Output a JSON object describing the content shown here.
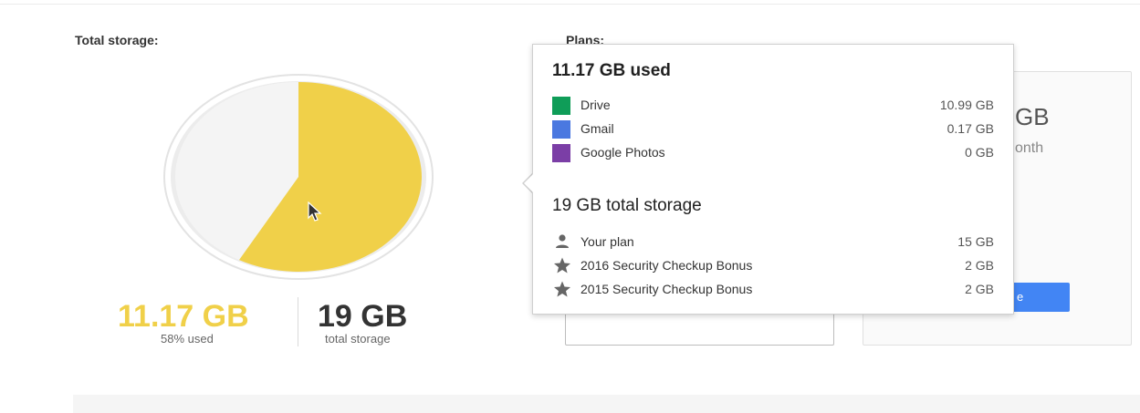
{
  "storage": {
    "label": "Total storage:",
    "used_value": "11.17 GB",
    "used_percent_text": "58% used",
    "used_fraction": 0.58,
    "total_value": "19 GB",
    "total_caption": "total storage"
  },
  "plans": {
    "label": "Plans:",
    "card2_size_partial": "GB",
    "card2_period_partial": "onth",
    "card2_button_partial": "e"
  },
  "popover": {
    "used_title": "11.17 GB used",
    "usage": [
      {
        "label": "Drive",
        "value": "10.99 GB",
        "color": "#0f9d58"
      },
      {
        "label": "Gmail",
        "value": "0.17 GB",
        "color": "#4a78e0"
      },
      {
        "label": "Google Photos",
        "value": "0 GB",
        "color": "#7b3ea6"
      }
    ],
    "total_title": "19 GB total storage",
    "sources": [
      {
        "label": "Your plan",
        "value": "15 GB",
        "icon": "person-icon"
      },
      {
        "label": "2016 Security Checkup Bonus",
        "value": "2 GB",
        "icon": "star-icon"
      },
      {
        "label": "2015 Security Checkup Bonus",
        "value": "2 GB",
        "icon": "star-icon"
      }
    ]
  },
  "colors": {
    "used_yellow": "#f0d049",
    "free_gray": "#f4f4f4",
    "accent_blue": "#4285f4"
  }
}
